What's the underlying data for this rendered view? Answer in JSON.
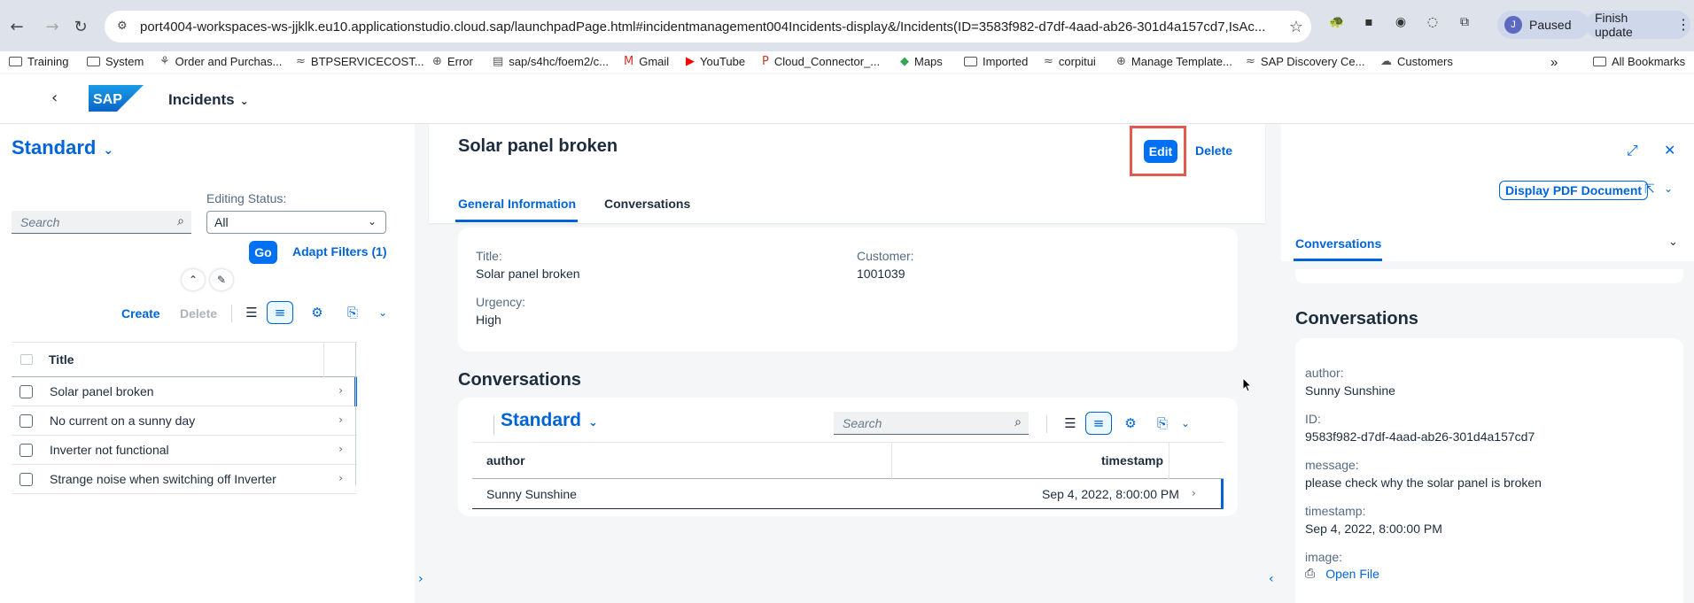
{
  "browser": {
    "url": "port4004-workspaces-ws-jjklk.eu10.applicationstudio.cloud.sap/launchpadPage.html#incidentmanagement004Incidents-display&/Incidents(ID=3583f982-d7df-4aad-ab26-301d4a157cd7,IsAc...",
    "profile_initial": "J",
    "profile_label": "Paused",
    "update_label": "Finish update",
    "bookmarks": [
      {
        "label": "Training",
        "icon": "folder-icon"
      },
      {
        "label": "System",
        "icon": "folder-icon"
      },
      {
        "label": "Order and Purchas...",
        "icon": "bookmark-icon"
      },
      {
        "label": "BTPSERVICECOST...",
        "icon": "sap-icon"
      },
      {
        "label": "Error",
        "icon": "globe-icon"
      },
      {
        "label": "sap/s4hc/foem2/c...",
        "icon": "bookmark-icon"
      },
      {
        "label": "Gmail",
        "icon": "gmail-icon"
      },
      {
        "label": "YouTube",
        "icon": "youtube-icon"
      },
      {
        "label": "Cloud_Connector_...",
        "icon": "ppt-icon"
      },
      {
        "label": "Maps",
        "icon": "maps-icon"
      },
      {
        "label": "Imported",
        "icon": "folder-icon"
      },
      {
        "label": "corpitui",
        "icon": "sap-icon"
      },
      {
        "label": "Manage Template...",
        "icon": "globe-icon"
      },
      {
        "label": "SAP Discovery Ce...",
        "icon": "sap-icon"
      },
      {
        "label": "Customers",
        "icon": "cloud-icon"
      }
    ],
    "more_bookmarks": "»",
    "all_bookmarks": "All Bookmarks"
  },
  "shell": {
    "logo_text": "SAP",
    "app_title": "Incidents"
  },
  "list": {
    "variant": "Standard",
    "search_placeholder": "Search",
    "editing_status_label": "Editing Status:",
    "editing_status_value": "All",
    "go_label": "Go",
    "adapt_filters": "Adapt Filters (1)",
    "create_label": "Create",
    "delete_label": "Delete",
    "column_title": "Title",
    "rows": [
      {
        "title": "Solar panel broken",
        "selected": true
      },
      {
        "title": "No current on a sunny day",
        "selected": false
      },
      {
        "title": "Inverter not functional",
        "selected": false
      },
      {
        "title": "Strange noise when switching off Inverter",
        "selected": false
      }
    ]
  },
  "object": {
    "title": "Solar panel broken",
    "edit_label": "Edit",
    "delete_label": "Delete",
    "tabs": [
      "General Information",
      "Conversations"
    ],
    "fields": {
      "title_label": "Title:",
      "title_value": "Solar panel broken",
      "customer_label": "Customer:",
      "customer_value": "1001039",
      "urgency_label": "Urgency:",
      "urgency_value": "High"
    },
    "conversations_title": "Conversations",
    "conv_variant": "Standard",
    "conv_search_placeholder": "Search",
    "conv_columns": {
      "author": "author",
      "timestamp": "timestamp"
    },
    "conv_rows": [
      {
        "author": "Sunny Sunshine",
        "timestamp": "Sep 4, 2022, 8:00:00 PM"
      }
    ]
  },
  "detail": {
    "pdf_label": "Display PDF Document",
    "tab": "Conversations",
    "title": "Conversations",
    "fields": {
      "author_label": "author:",
      "author_value": "Sunny Sunshine",
      "id_label": "ID:",
      "id_value": "9583f982-d7df-4aad-ab26-301d4a157cd7",
      "message_label": "message:",
      "message_value": "please check why the solar panel is broken",
      "timestamp_label": "timestamp:",
      "timestamp_value": "Sep 4, 2022, 8:00:00 PM",
      "image_label": "image:",
      "open_file": "Open File"
    }
  },
  "colors": {
    "accent": "#0064d9",
    "emphasized_button": "#0070f2",
    "highlight_frame": "#e25a4f"
  }
}
